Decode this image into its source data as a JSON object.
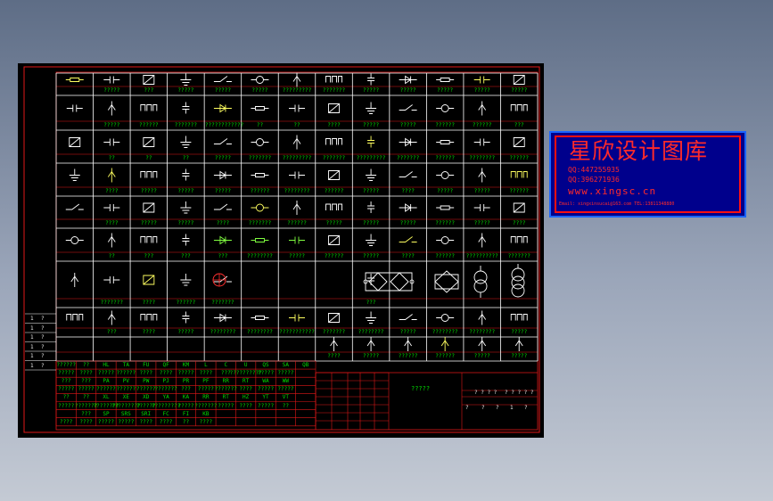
{
  "drawing": {
    "colors": {
      "background": "#000000",
      "frame": "#e01818",
      "grid": "#ffffff",
      "symbol": "#ffffff",
      "text": "#00dc00",
      "accent": "#ffff00"
    },
    "row_labels": [
      [
        "?????",
        "???",
        "?????",
        "?????",
        "?????",
        "?????????",
        "???????",
        "?????",
        "?????",
        "?????",
        "?????",
        "?????"
      ],
      [
        "?????",
        "??????",
        "???????",
        "????????????",
        "??",
        "??",
        "????",
        "?????",
        "?????",
        "??????",
        "??????",
        "???"
      ],
      [
        "??",
        "??",
        "??",
        "?????",
        "???????",
        "?????????",
        "???????",
        "?????????",
        "???????",
        "??????",
        "????????",
        "??????"
      ],
      [
        "????",
        "?????",
        "?????",
        "?????",
        "??????",
        "????????",
        "??????",
        "?????",
        "????",
        "?????",
        "?????",
        "??????"
      ],
      [
        "????",
        "?????",
        "?????",
        "????",
        "???????",
        "??????",
        "?????",
        "?????",
        "?????",
        "??????",
        "?????",
        "????"
      ],
      [
        "??",
        "???",
        "???",
        "???",
        "????????",
        "?????",
        "??????",
        "?????",
        "????",
        "??????",
        "??????????",
        "???????"
      ],
      [
        "???????",
        "????",
        "??????",
        "???????",
        "??",
        "",
        "",
        "???",
        "????",
        "????????????",
        "??????",
        "?????????????"
      ],
      [
        "???",
        "????",
        "?????",
        "????????",
        "????????",
        "???????????",
        "???????",
        "????????",
        "?????",
        "????????",
        "????????",
        "?????"
      ]
    ],
    "row9_labels": [
      "????",
      "?????",
      "??????",
      "??????",
      "?????",
      "?????"
    ],
    "left_boxes": [
      "1",
      "?",
      "1",
      "?",
      "1",
      "?",
      "1",
      "?",
      "1",
      "?",
      "1",
      "?"
    ],
    "codes_row1": [
      "??????",
      "??",
      "HL",
      "TA",
      "FU",
      "QF",
      "KM",
      "L",
      "C",
      "U",
      "QS",
      "SA",
      "QB"
    ],
    "codes_row2": [
      "?????",
      "????",
      "?????",
      "??????",
      "????",
      "????",
      "?????",
      "????",
      "???",
      "??????????",
      "?????",
      "?????"
    ],
    "codes_row3": [
      "???",
      "???",
      "PA",
      "PV",
      "PW",
      "PJ",
      "PR",
      "PF",
      "RR",
      "RT",
      "WA",
      "WW"
    ],
    "codes_row4": [
      "?????",
      "?????",
      "??????",
      "??????",
      "??????",
      "???????",
      "???",
      "?????",
      "???????",
      "????",
      "?????",
      "?????"
    ],
    "codes_row5": [
      "??",
      "??",
      "XL",
      "XE",
      "XD",
      "YA",
      "KA",
      "RR",
      "RT",
      "HZ",
      "YT",
      "VT"
    ],
    "codes_row6": [
      "?????",
      "???????",
      "????????",
      "?????????",
      "??????",
      "?????????",
      "?????",
      "???????",
      "?????",
      "????",
      "?????",
      "??"
    ],
    "codes_row7": [
      "???",
      "SP",
      "SRS",
      "SRI",
      "FC",
      "FI",
      "KB"
    ],
    "codes_row8": [
      "????",
      "????",
      "?????",
      "?????",
      "????",
      "????",
      "??",
      "????"
    ],
    "title_center": "?????",
    "title_sheet": [
      "? ? ? ?",
      "? ? ? ? ?",
      "?",
      "?",
      "?",
      "1",
      "?"
    ]
  },
  "brand": {
    "title": "星欣设计图库",
    "qq1": "QQ:447255935",
    "qq2": "QQ:396271936",
    "url": "www.xingsc.cn",
    "email": "Email: xingxinsucai@163.com   TEL:13811348880"
  }
}
